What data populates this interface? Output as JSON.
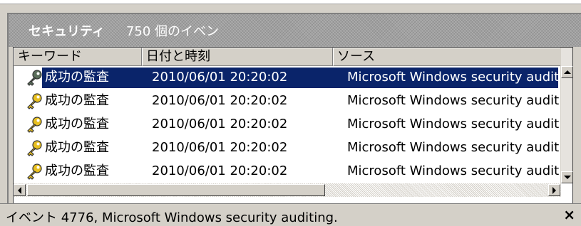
{
  "header": {
    "title": "セキュリティ",
    "count": "750 個のイベン"
  },
  "columns": [
    "キーワード",
    "日付と時刻",
    "ソース"
  ],
  "rows": [
    {
      "keyword": "成功の監査",
      "datetime": "2010/06/01 20:20:02",
      "source": "Microsoft Windows security auditing.",
      "selected": true
    },
    {
      "keyword": "成功の監査",
      "datetime": "2010/06/01 20:20:02",
      "source": "Microsoft Windows security auditing.",
      "selected": false
    },
    {
      "keyword": "成功の監査",
      "datetime": "2010/06/01 20:20:02",
      "source": "Microsoft Windows security auditing.",
      "selected": false
    },
    {
      "keyword": "成功の監査",
      "datetime": "2010/06/01 20:20:02",
      "source": "Microsoft Windows security auditing.",
      "selected": false
    },
    {
      "keyword": "成功の監査",
      "datetime": "2010/06/01 20:20:02",
      "source": "Microsoft Windows security auditing.",
      "selected": false
    }
  ],
  "icons": {
    "row_icon": "key-icon"
  },
  "colors": {
    "selection": "#0a246a",
    "key_gold": "#e8c020",
    "key_selected": "#5a6e5a"
  },
  "status": {
    "text": "イベント 4776, Microsoft Windows security auditing.",
    "close": "×"
  }
}
